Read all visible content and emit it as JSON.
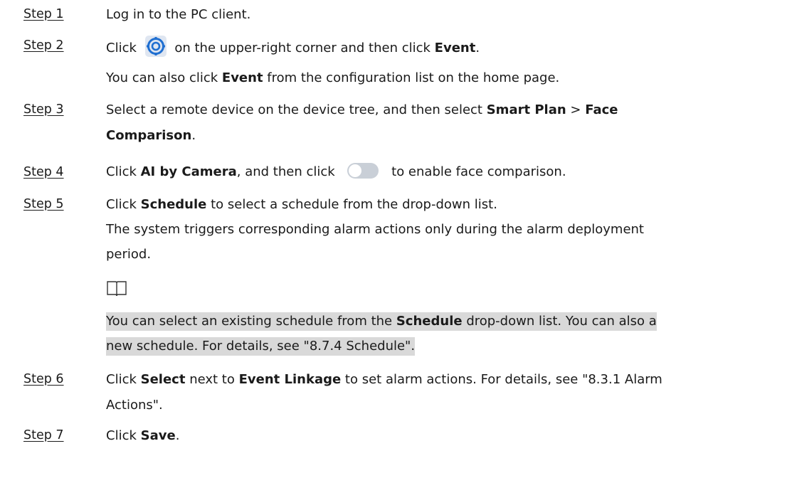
{
  "steps": [
    {
      "label": "Step 1"
    },
    {
      "label": "Step 2"
    },
    {
      "label": "Step 3"
    },
    {
      "label": "Step 4"
    },
    {
      "label": "Step 5"
    },
    {
      "label": "Step 6"
    },
    {
      "label": "Step 7"
    }
  ],
  "step1": {
    "text": "Log in to the PC client."
  },
  "step2": {
    "pre": "Click",
    "icon": "settings-gear-icon",
    "post": "on the upper-right corner and then click",
    "bold": "Event",
    "end": ".",
    "sub_pre": "You can also click",
    "sub_bold": "Event",
    "sub_post": "from the configuration list on the home page."
  },
  "step3": {
    "pre": "Select a remote device on the device tree, and then select",
    "bold1": "Smart Plan",
    "sep": ">",
    "bold2": "Face",
    "bold3": "Comparison",
    "end": "."
  },
  "step4": {
    "pre": "Click",
    "bold": "AI by Camera",
    "mid": ", and then click",
    "icon": "toggle-switch-icon",
    "post": "to enable face comparison."
  },
  "step5": {
    "pre": "Click",
    "bold": "Schedule",
    "post": "to select a schedule from the drop-down list.",
    "sub_line1": "The system triggers corresponding alarm actions only during the alarm deployment",
    "sub_line2": "period."
  },
  "note": {
    "icon": "note-book-icon",
    "line1_pre": "You can select an existing schedule from the",
    "line1_bold": "Schedule",
    "line1_post": "drop-down list. You can also a",
    "line2": "new schedule. For details, see \"8.7.4 Schedule\"."
  },
  "step6": {
    "pre": "Click",
    "bold1": "Select",
    "mid": "next to",
    "bold2": "Event Linkage",
    "post": "to set alarm actions. For details, see \"8.3.1 Alarm",
    "line2": "Actions\"."
  },
  "step7": {
    "pre": "Click",
    "bold": "Save",
    "end": "."
  },
  "colors": {
    "text": "#1a1a1a",
    "note_highlight": "#d9d9d9",
    "icon_bg": "#dfe6f1",
    "icon_accent": "#1f6fd1",
    "toggle_track": "#c9cfd7"
  }
}
